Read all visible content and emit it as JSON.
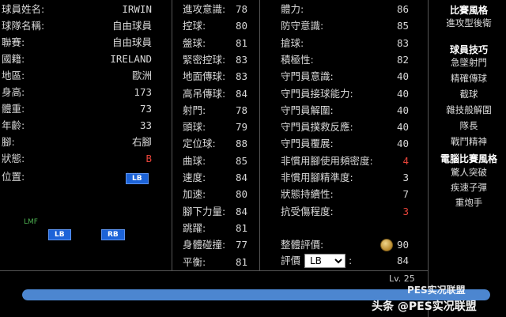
{
  "profile": {
    "rows": [
      {
        "label": "球員姓名:",
        "value": "IRWIN"
      },
      {
        "label": "球隊名稱:",
        "value": "自由球員"
      },
      {
        "label": "聯賽:",
        "value": "自由球員"
      },
      {
        "label": "國籍:",
        "value": "IRELAND"
      },
      {
        "label": "地區:",
        "value": "歐洲"
      },
      {
        "label": "身高:",
        "value": "173"
      },
      {
        "label": "體重:",
        "value": "73"
      },
      {
        "label": "年齡:",
        "value": "33"
      },
      {
        "label": "腳:",
        "value": "右腳"
      },
      {
        "label": "狀態:",
        "value": "B"
      }
    ],
    "position_label": "位置:",
    "position_value": "LB",
    "field_labels": {
      "lmf": "LMF",
      "lb": "LB",
      "rb": "RB"
    }
  },
  "attributes_col1": [
    {
      "label": "進攻意識:",
      "value": "78"
    },
    {
      "label": "控球:",
      "value": "80"
    },
    {
      "label": "盤球:",
      "value": "81"
    },
    {
      "label": "緊密控球:",
      "value": "83"
    },
    {
      "label": "地面傳球:",
      "value": "83"
    },
    {
      "label": "高吊傳球:",
      "value": "84"
    },
    {
      "label": "射門:",
      "value": "78"
    },
    {
      "label": "頭球:",
      "value": "79"
    },
    {
      "label": "定位球:",
      "value": "88"
    },
    {
      "label": "曲球:",
      "value": "85"
    },
    {
      "label": "速度:",
      "value": "84"
    },
    {
      "label": "加速:",
      "value": "80"
    },
    {
      "label": "腳下力量:",
      "value": "84"
    },
    {
      "label": "跳躍:",
      "value": "81"
    },
    {
      "label": "身體碰撞:",
      "value": "77"
    },
    {
      "label": "平衡:",
      "value": "81"
    }
  ],
  "attributes_col2": [
    {
      "label": "體力:",
      "value": "86",
      "red": false
    },
    {
      "label": "防守意識:",
      "value": "85",
      "red": false
    },
    {
      "label": "搶球:",
      "value": "83",
      "red": false
    },
    {
      "label": "積極性:",
      "value": "82",
      "red": false
    },
    {
      "label": "守門員意識:",
      "value": "40",
      "red": false
    },
    {
      "label": "守門員接球能力:",
      "value": "40",
      "red": false
    },
    {
      "label": "守門員解圍:",
      "value": "40",
      "red": false
    },
    {
      "label": "守門員撲救反應:",
      "value": "40",
      "red": false
    },
    {
      "label": "守門員覆展:",
      "value": "40",
      "red": false
    },
    {
      "label": "非慣用腳使用頻密度:",
      "value": "4",
      "red": true
    },
    {
      "label": "非慣用腳精準度:",
      "value": "3",
      "red": false
    },
    {
      "label": "狀態持續性:",
      "value": "7",
      "red": false
    },
    {
      "label": "抗受傷程度:",
      "value": "3",
      "red": true
    }
  ],
  "rating": {
    "overall_label": "整體評價:",
    "overall_value": "90",
    "eval_label": "評價",
    "eval_select": "LB",
    "eval_value": "84"
  },
  "sidebar": {
    "style_title": "比賽風格",
    "style_items": [
      "進攻型後衛"
    ],
    "skills_title": "球員技巧",
    "skills_items": [
      "急墜射門",
      "精確傳球",
      "截球",
      "雜技般解圍",
      "隊長",
      "戰鬥精神"
    ],
    "ai_title": "電腦比賽風格",
    "ai_items": [
      "驚人突破",
      "疾速子彈",
      "重炮手"
    ]
  },
  "level": {
    "text": "Lv. 25",
    "progress": 1.0
  },
  "watermarks": {
    "top": "PES实况联盟",
    "bottom": "头条 @PES实况联盟"
  },
  "colors": {
    "accent": "#1c63d8",
    "warn": "#e8443a",
    "bar": "#4c86d0"
  }
}
